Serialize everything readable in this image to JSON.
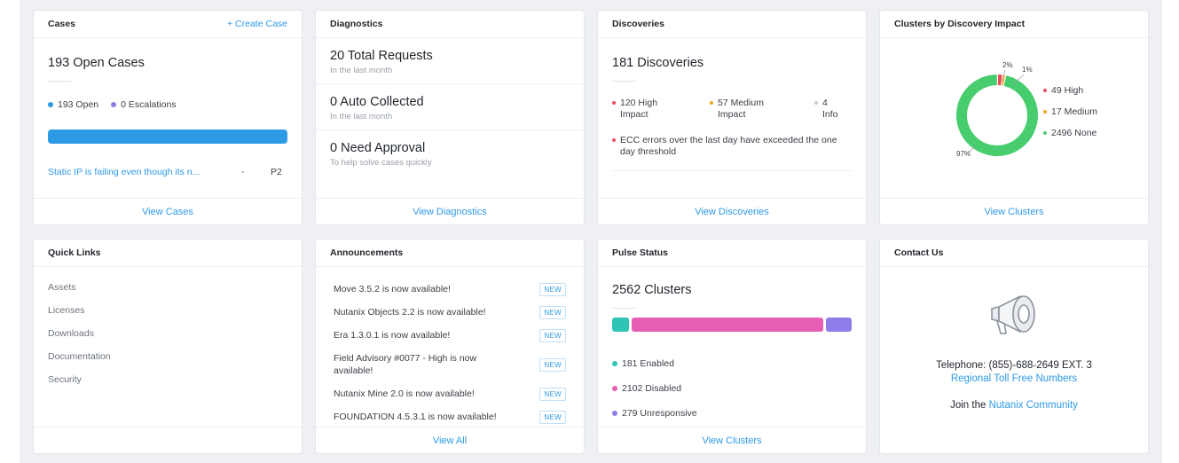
{
  "colors": {
    "link": "#2e9ae6",
    "open": "#2e9ae6",
    "escalations": "#8e7ce8",
    "high": "#ea4d5a",
    "medium": "#f5a623",
    "info": "#c6cbd2",
    "none": "#47cd6e",
    "enabled": "#2ec4b6",
    "disabled": "#e65fb4",
    "unresponsive": "#8e7ce8"
  },
  "cases": {
    "title": "Cases",
    "create_link": "+ Create Case",
    "open_count": "193 Open Cases",
    "legend": [
      {
        "label": "193 Open",
        "color": "#2e9ae6"
      },
      {
        "label": "0 Escalations",
        "color": "#8e7ce8"
      }
    ],
    "open_fraction": 1.0,
    "case_title": "Static IP is failing even though its n...",
    "case_sep": "-",
    "case_priority": "P2",
    "footer": "View Cases"
  },
  "diagnostics": {
    "title": "Diagnostics",
    "blocks": [
      {
        "value": "20 Total Requests",
        "sub": "In the last month"
      },
      {
        "value": "0 Auto Collected",
        "sub": "In the last month"
      },
      {
        "value": "0 Need Approval",
        "sub": "To help solve cases quickly"
      }
    ],
    "footer": "View Diagnostics"
  },
  "discoveries": {
    "title": "Discoveries",
    "count": "181 Discoveries",
    "impacts": [
      {
        "label": "120 High Impact",
        "color": "#ea4d5a"
      },
      {
        "label": "57 Medium Impact",
        "color": "#f5a623"
      },
      {
        "label": "4 Info",
        "color": "#c6cbd2"
      }
    ],
    "message": "ECC errors over the last day have exceeded the one day threshold",
    "footer": "View Discoveries"
  },
  "clusters_impact": {
    "title": "Clusters by Discovery Impact",
    "labels": {
      "high_pct": "2%",
      "medium_pct": "1%",
      "none_pct": "97%"
    },
    "legend": [
      {
        "label": "49 High",
        "color": "#ea4d5a"
      },
      {
        "label": "17 Medium",
        "color": "#f5a623"
      },
      {
        "label": "2496 None",
        "color": "#47cd6e"
      }
    ],
    "values": {
      "high": 49,
      "medium": 17,
      "none": 2496
    },
    "footer": "View Clusters"
  },
  "quick_links": {
    "title": "Quick Links",
    "items": [
      "Assets",
      "Licenses",
      "Downloads",
      "Documentation",
      "Security"
    ]
  },
  "announcements": {
    "title": "Announcements",
    "items": [
      {
        "text": "Move 3.5.2 is now available!",
        "badge": "NEW"
      },
      {
        "text": "Nutanix Objects 2.2 is now available!",
        "badge": "NEW"
      },
      {
        "text": "Era 1.3.0.1 is now available!",
        "badge": "NEW"
      },
      {
        "text": "Field Advisory #0077 - High is now available!",
        "badge": "NEW"
      },
      {
        "text": "Nutanix Mine 2.0 is now available!",
        "badge": "NEW"
      },
      {
        "text": "FOUNDATION 4.5.3.1 is now available!",
        "badge": "NEW"
      }
    ],
    "footer": "View All"
  },
  "pulse": {
    "title": "Pulse Status",
    "count": "2562 Clusters",
    "values": {
      "enabled": 181,
      "disabled": 2102,
      "unresponsive": 279
    },
    "legend": [
      {
        "label": "181 Enabled",
        "color": "#2ec4b6"
      },
      {
        "label": "2102 Disabled",
        "color": "#e65fb4"
      },
      {
        "label": "279 Unresponsive",
        "color": "#8e7ce8"
      }
    ],
    "footer": "View Clusters"
  },
  "contact": {
    "title": "Contact Us",
    "icon": "megaphone-icon",
    "telephone": "Telephone: (855)-688-2649 EXT. 3",
    "toll_free": "Regional Toll Free Numbers",
    "join_prefix": "Join the",
    "community": "Nutanix Community"
  }
}
